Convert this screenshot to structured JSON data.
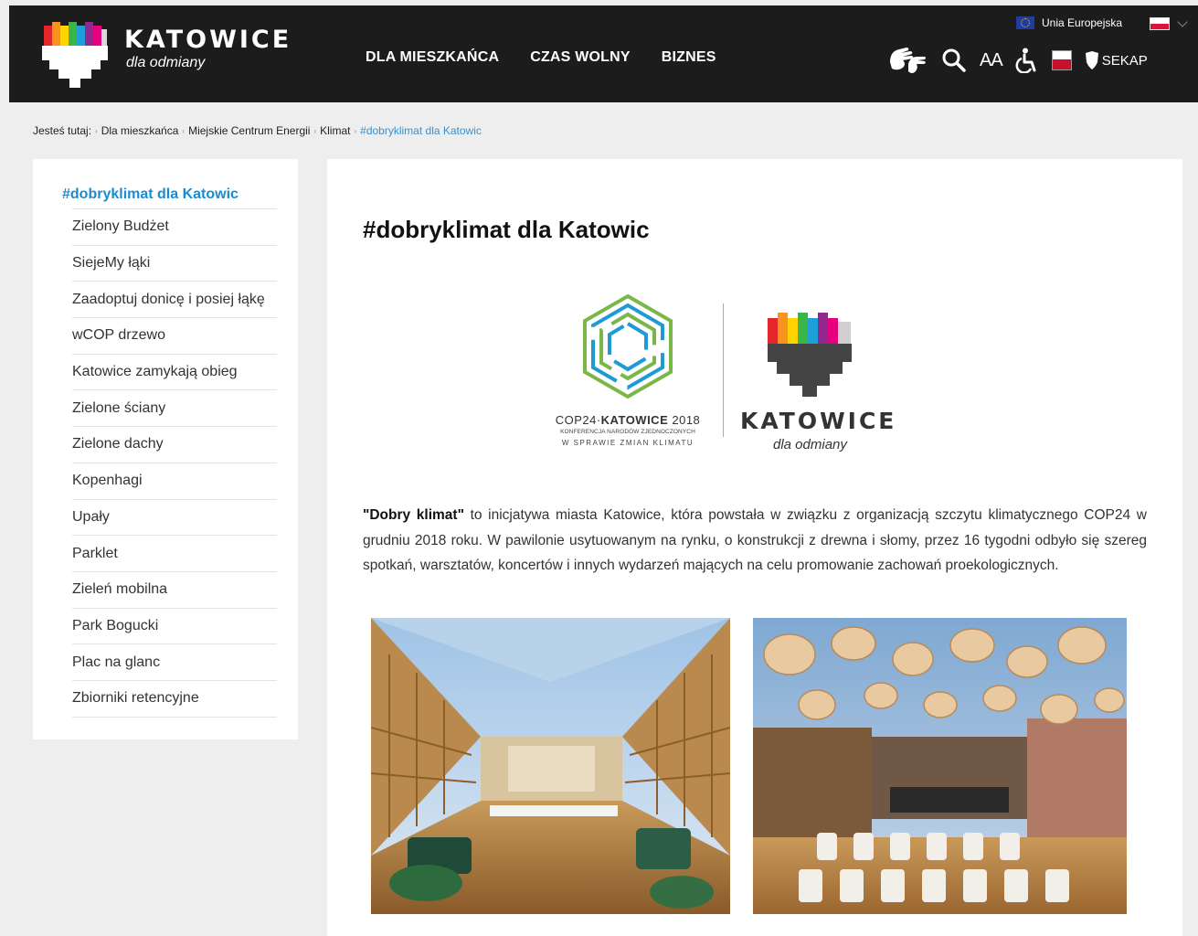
{
  "header": {
    "logo_word": "KATOWICE",
    "logo_tag": "dla odmiany",
    "nav": [
      "DLA MIESZKAŃCA",
      "CZAS WOLNY",
      "BIZNES"
    ],
    "eu_label": "Unia Europejska",
    "text_size_label": "AA",
    "sekap_label": "SEKAP"
  },
  "breadcrumb": {
    "prefix": "Jesteś tutaj:",
    "items": [
      "Dla mieszkańca",
      "Miejskie Centrum Energii",
      "Klimat"
    ],
    "current": "#dobryklimat dla Katowic"
  },
  "sidebar": {
    "title": "#dobryklimat dla Katowic",
    "items": [
      "Zielony Budżet",
      "SiejeMy łąki",
      "Zaadoptuj donicę i posiej łąkę",
      "wCOP drzewo",
      "Katowice zamykają obieg",
      "Zielone ściany",
      "Zielone dachy",
      "Kopenhagi",
      "Upały",
      "Parklet",
      "Zieleń mobilna",
      "Park Bogucki",
      "Plac na glanc",
      "Zbiorniki retencyjne"
    ]
  },
  "main": {
    "title": "#dobryklimat dla Katowic",
    "cop_line1_a": "COP24·",
    "cop_line1_b": "KATOWICE",
    "cop_line1_c": " 2018",
    "cop_line2": "KONFERENCJA NARODÓW ZJEDNOCZONYCH",
    "cop_line3": "W SPRAWIE ZMIAN KLIMATU",
    "kato_word": "KATOWICE",
    "kato_tag": "dla odmiany",
    "intro_bold": "\"Dobry klimat\"",
    "intro_text": " to inicjatywa miasta Katowice, która powstała w związku z organizacją szczytu klimatycznego COP24 w grudniu 2018 roku. W pawilonie usytuowanym na rynku, o konstrukcji z drewna i słomy, przez 16 tygodni odbyło się szereg spotkań, warsztatów, koncertów i innych wydarzeń mających na celu promowanie zachowań proekologicznych."
  },
  "colors": {
    "header_bg": "#1c1c1c",
    "accent": "#1a8bd1",
    "logo_red": "#e4262a",
    "logo_orange": "#f7931e",
    "logo_yellow": "#ffd400",
    "logo_green": "#39b54a",
    "logo_blue": "#1e9fd8",
    "logo_purple": "#92278f",
    "logo_magenta": "#e6007e",
    "cop_green": "#7ab648",
    "cop_blue": "#1e9bd7"
  }
}
